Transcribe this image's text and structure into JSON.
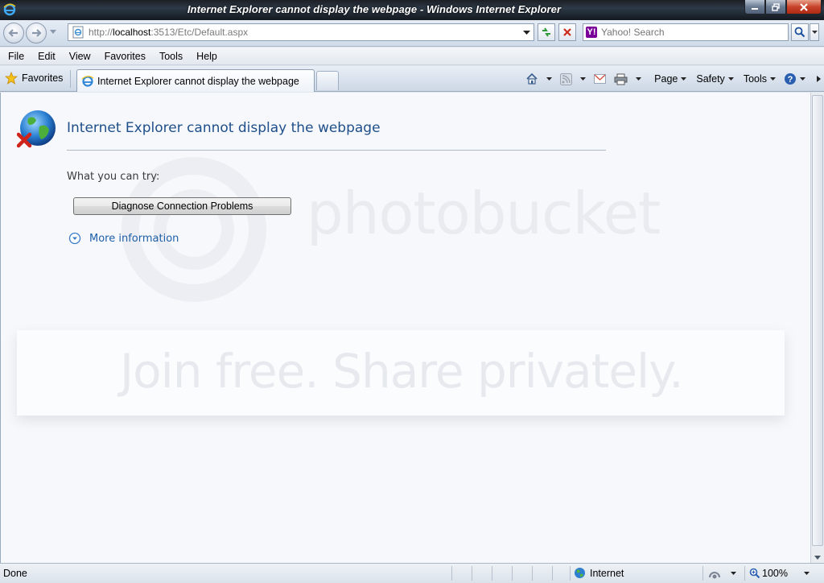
{
  "window": {
    "title": "Internet Explorer cannot display the webpage - Windows Internet Explorer"
  },
  "address": {
    "url_prefix": "http://",
    "url_host": "localhost",
    "url_rest": ":3513/Etc/Default.aspx"
  },
  "search": {
    "placeholder": "Yahoo! Search",
    "provider_icon": "Y!"
  },
  "menu": [
    "File",
    "Edit",
    "View",
    "Favorites",
    "Tools",
    "Help"
  ],
  "tabbar": {
    "favorites_label": "Favorites",
    "active_tab": "Internet Explorer cannot display the webpage",
    "commands": {
      "page": "Page",
      "safety": "Safety",
      "tools": "Tools"
    }
  },
  "content": {
    "heading": "Internet Explorer cannot display the webpage",
    "try_label": "What you can try:",
    "diagnose_button": "Diagnose Connection Problems",
    "more_info": "More information",
    "watermark_logo": "photobucket",
    "watermark_tagline": "Join free. Share privately."
  },
  "status": {
    "text": "Done",
    "zone": "Internet",
    "zoom": "100%"
  },
  "colors": {
    "heading": "#1f4f8a",
    "link": "#1f5fa8"
  }
}
